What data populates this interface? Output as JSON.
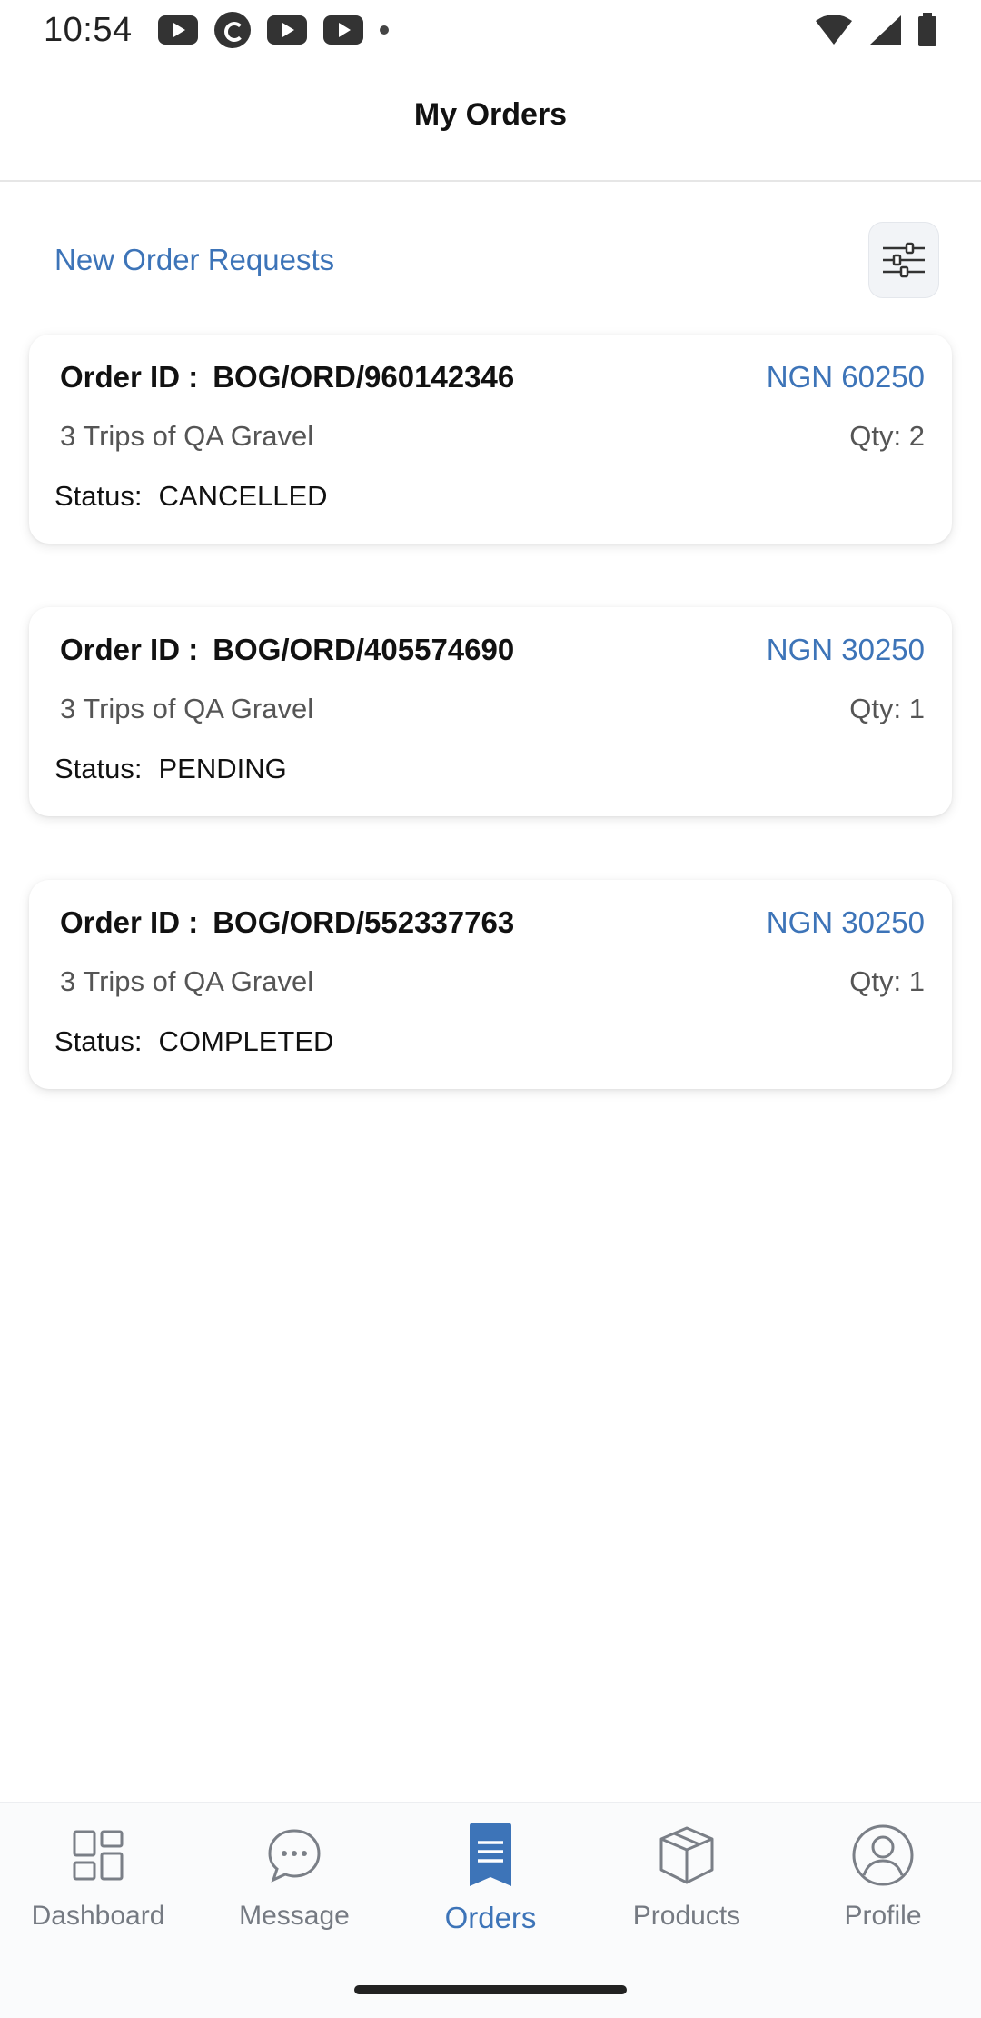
{
  "status_bar": {
    "time": "10:54"
  },
  "header": {
    "title": "My Orders"
  },
  "section": {
    "title": "New Order Requests"
  },
  "orders": [
    {
      "id_label": "Order ID :",
      "id": "BOG/ORD/960142346",
      "price": "NGN 60250",
      "description": "3 Trips of QA Gravel",
      "qty": "Qty: 2",
      "status_label": "Status:",
      "status": "CANCELLED"
    },
    {
      "id_label": "Order ID :",
      "id": "BOG/ORD/405574690",
      "price": "NGN 30250",
      "description": "3 Trips of QA Gravel",
      "qty": "Qty: 1",
      "status_label": "Status:",
      "status": "PENDING"
    },
    {
      "id_label": "Order ID :",
      "id": "BOG/ORD/552337763",
      "price": "NGN 30250",
      "description": "3 Trips of QA Gravel",
      "qty": "Qty: 1",
      "status_label": "Status:",
      "status": "COMPLETED"
    }
  ],
  "bottom_nav": {
    "items": [
      {
        "label": "Dashboard",
        "icon": "dashboard-icon"
      },
      {
        "label": "Message",
        "icon": "message-icon"
      },
      {
        "label": "Orders",
        "icon": "orders-icon",
        "active": true
      },
      {
        "label": "Products",
        "icon": "products-icon"
      },
      {
        "label": "Profile",
        "icon": "profile-icon"
      }
    ]
  },
  "colors": {
    "accent": "#3d74b8",
    "text": "#111111",
    "muted": "#555555",
    "nav_inactive": "#757a82"
  }
}
